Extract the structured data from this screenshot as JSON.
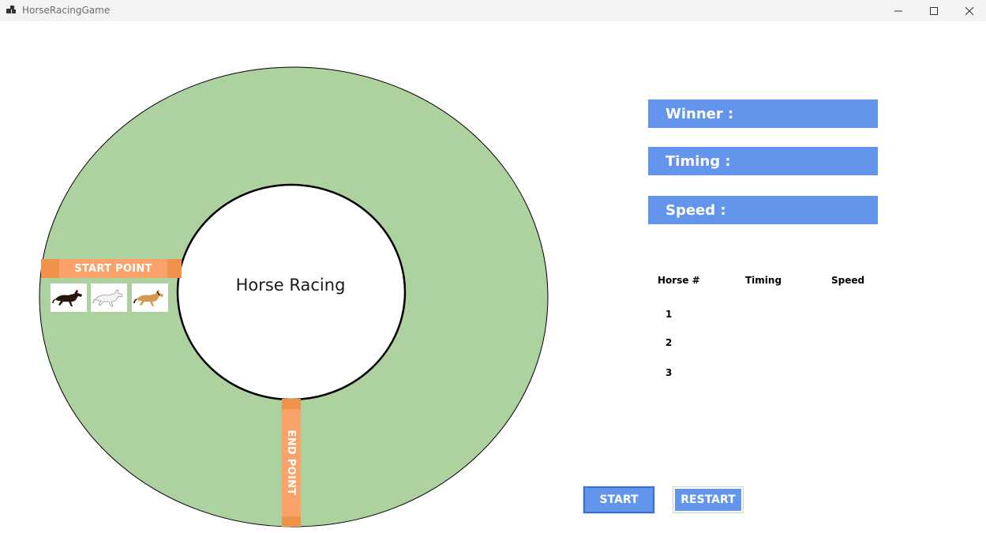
{
  "window": {
    "title": "HorseRacingGame"
  },
  "track": {
    "center_label": "Horse Racing",
    "start_label": "START POINT",
    "end_label": "END POINT",
    "horses": [
      {
        "icon": "dark-brown-horse-icon"
      },
      {
        "icon": "white-horse-icon"
      },
      {
        "icon": "tan-horse-icon"
      }
    ]
  },
  "results": {
    "winner_label": "Winner :",
    "timing_label": "Timing :",
    "speed_label": "Speed :"
  },
  "table": {
    "headers": [
      "Horse #",
      "Timing",
      "Speed"
    ],
    "rows": [
      {
        "horse": "1",
        "timing": "",
        "speed": ""
      },
      {
        "horse": "2",
        "timing": "",
        "speed": ""
      },
      {
        "horse": "3",
        "timing": "",
        "speed": ""
      }
    ]
  },
  "buttons": {
    "start": "START",
    "restart": "RESTART"
  },
  "colors": {
    "track_fill": "#aed1a0",
    "accent_blue": "#6495ed",
    "marker_orange": "#f0924a",
    "marker_orange_light": "#fba26a"
  }
}
